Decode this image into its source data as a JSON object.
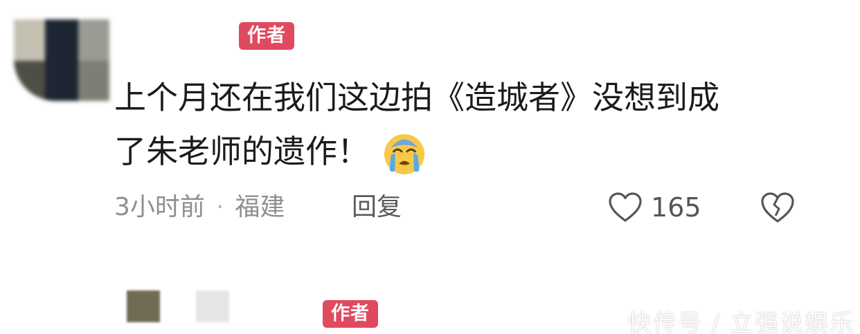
{
  "comment": {
    "author_badge": "作者",
    "text_line1": "上个月还在我们这边拍《造城者》没想到成",
    "text_line2": "了朱老师的遗作！",
    "emoji": "crying-face-icon",
    "time": "3小时前",
    "location": "福建",
    "separator": "·",
    "reply_label": "回复",
    "like_count": "165"
  },
  "reply_preview": {
    "author_badge": "作者"
  },
  "watermark": "快传号 / 立强说娱乐",
  "colors": {
    "badge": "#e04a5f",
    "text": "#1b1b1b",
    "meta": "#8f8f8f"
  }
}
